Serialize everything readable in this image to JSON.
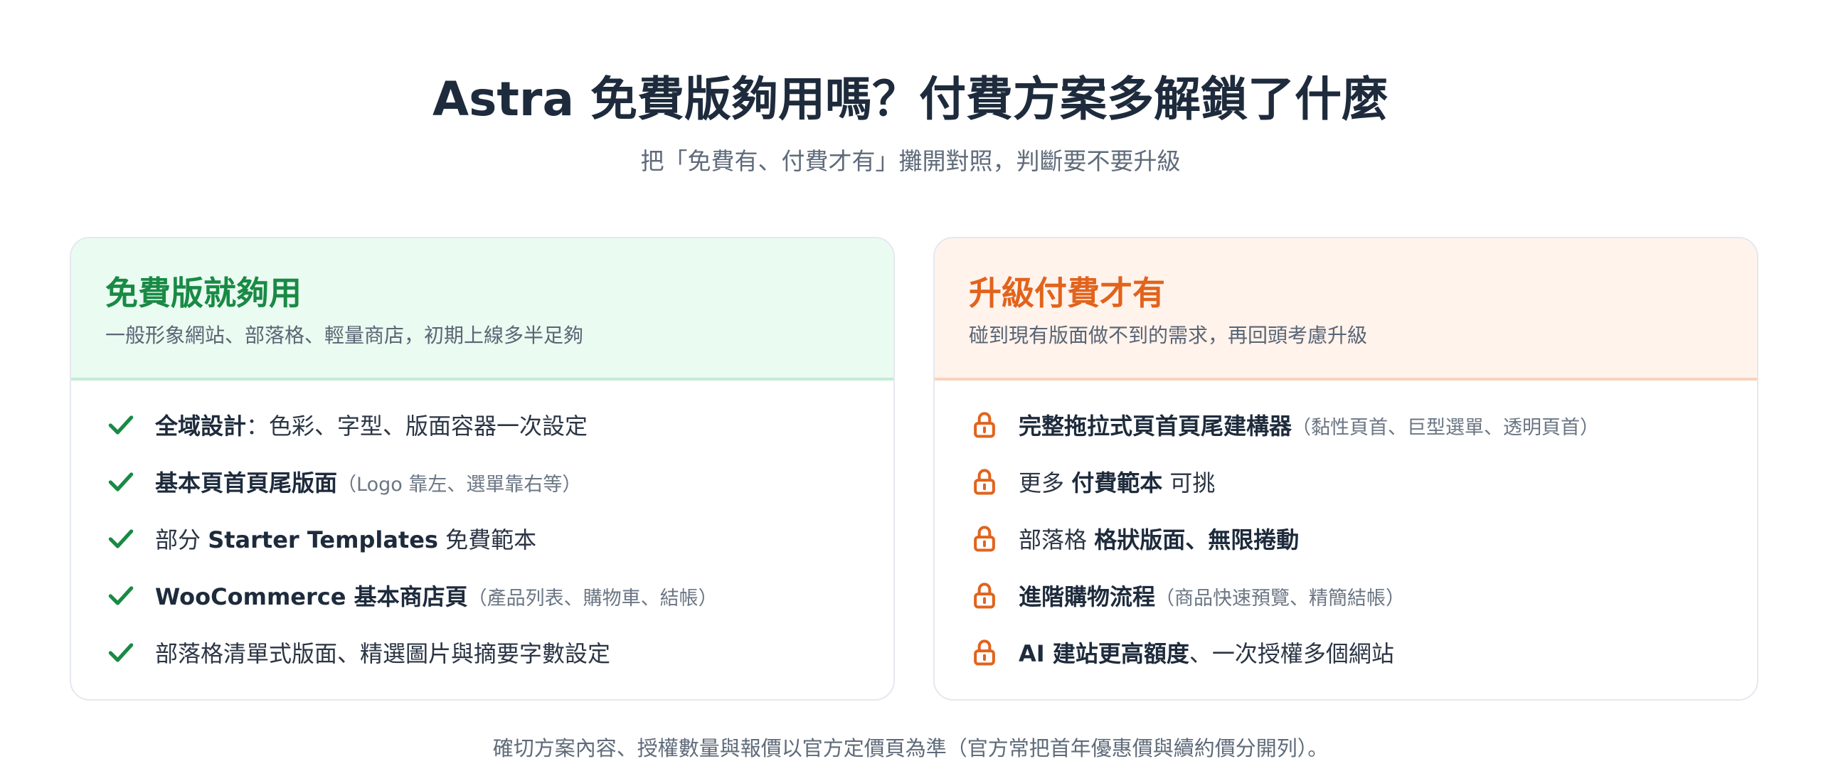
{
  "header": {
    "title": "Astra 免費版夠用嗎？付費方案多解鎖了什麼",
    "subtitle": "把「免費有、付費才有」攤開對照，判斷要不要升級"
  },
  "free_card": {
    "title": "免費版就夠用",
    "description": "一般形象網站、部落格、輕量商店，初期上線多半足夠",
    "accent": "#198a45",
    "icon": "check-icon",
    "items": [
      {
        "pre": "",
        "bold": "全域設計",
        "post": "：色彩、字型、版面容器一次設定",
        "note": ""
      },
      {
        "pre": "",
        "bold": "基本頁首頁尾版面",
        "post": "",
        "note": "（Logo 靠左、選單靠右等）"
      },
      {
        "pre": "部分 ",
        "bold": "Starter Templates",
        "post": " 免費範本",
        "note": ""
      },
      {
        "pre": "",
        "bold": "WooCommerce 基本商店頁",
        "post": "",
        "note": "（產品列表、購物車、結帳）"
      },
      {
        "pre": "部落格清單式版面、精選圖片與摘要字數設定",
        "bold": "",
        "post": "",
        "note": ""
      }
    ]
  },
  "paid_card": {
    "title": "升級付費才有",
    "description": "碰到現有版面做不到的需求，再回頭考慮升級",
    "accent": "#e2631c",
    "icon": "lock-icon",
    "items": [
      {
        "pre": "",
        "bold": "完整拖拉式頁首頁尾建構器",
        "post": "",
        "note": "（黏性頁首、巨型選單、透明頁首）"
      },
      {
        "pre": "更多 ",
        "bold": "付費範本",
        "post": " 可挑",
        "note": ""
      },
      {
        "pre": "部落格 ",
        "bold": "格狀版面、無限捲動",
        "post": "",
        "note": ""
      },
      {
        "pre": "",
        "bold": "進階購物流程",
        "post": "",
        "note": "（商品快速預覽、精簡結帳）"
      },
      {
        "pre": "",
        "bold": "AI 建站更高額度",
        "post": "、一次授權多個網站",
        "note": ""
      }
    ]
  },
  "footer": {
    "text": "確切方案內容、授權數量與報價以官方定價頁為準（官方常把首年優惠價與續約價分開列）。"
  }
}
